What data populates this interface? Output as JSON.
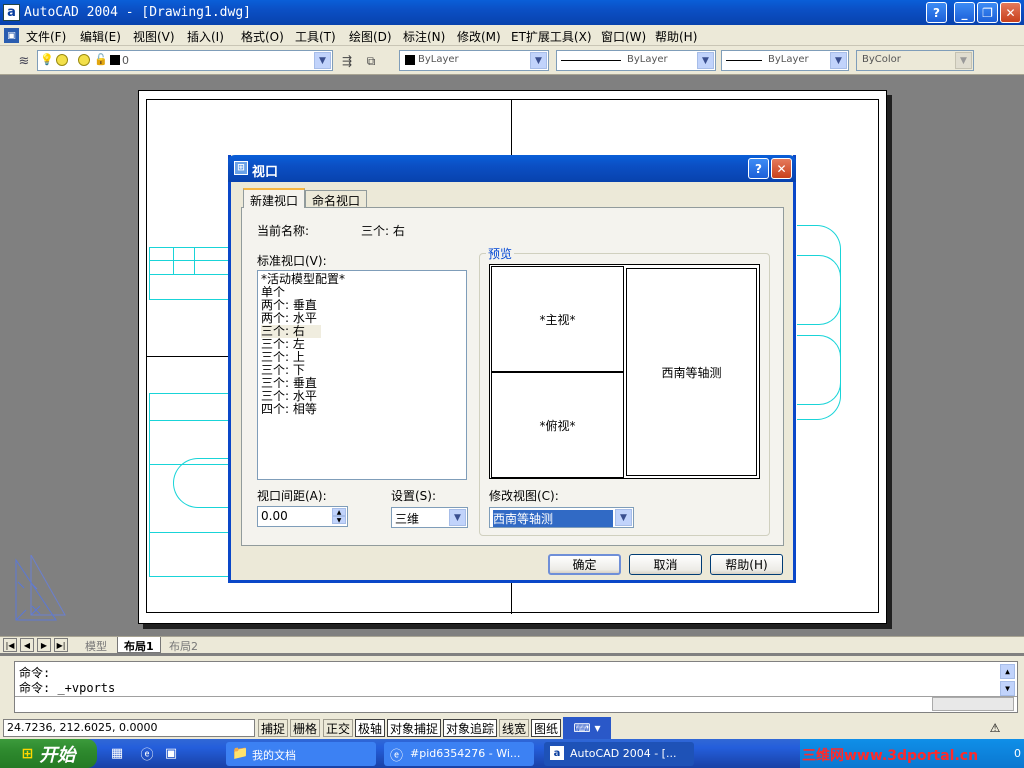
{
  "window": {
    "title": "AutoCAD 2004 - [Drawing1.dwg]",
    "controls": {
      "help": "?",
      "minimize": "_",
      "restore": "❐",
      "close": "✕"
    }
  },
  "menu": [
    "文件(F)",
    "编辑(E)",
    "视图(V)",
    "插入(I)",
    "格式(O)",
    "工具(T)",
    "绘图(D)",
    "标注(N)",
    "修改(M)",
    "ET扩展工具(X)",
    "窗口(W)",
    "帮助(H)"
  ],
  "toolbar": {
    "layer_value": "0",
    "color_value": "ByLayer",
    "linetype_value": "ByLayer",
    "lineweight_value": "ByLayer",
    "plotstyle_value": "ByColor"
  },
  "layout_tabs": [
    "模型",
    "布局1",
    "布局2"
  ],
  "command_lines": [
    "命令:",
    "命令: _+vports"
  ],
  "status": {
    "coords": "24.7236,  212.6025, 0.0000",
    "buttons": [
      "捕捉",
      "栅格",
      "正交",
      "极轴",
      "对象捕捉",
      "对象追踪",
      "线宽",
      "图纸"
    ]
  },
  "taskbar": {
    "start": "开始",
    "tasks": [
      "我的文档",
      "#pid6354276 - Wi...",
      "AutoCAD 2004 - [..."
    ],
    "watermark": "三维网www.3dportal.cn",
    "clock": "0"
  },
  "dialog": {
    "title": "视口",
    "tabs": [
      "新建视口",
      "命名视口"
    ],
    "current_name_label": "当前名称:",
    "current_name_value": "三个: 右",
    "standard_label": "标准视口(V):",
    "list": [
      "*活动模型配置*",
      "单个",
      "两个: 垂直",
      "两个: 水平",
      "三个: 右",
      "三个: 左",
      "三个: 上",
      "三个: 下",
      "三个: 垂直",
      "三个: 水平",
      "四个: 相等"
    ],
    "selected_index": 4,
    "preview_label": "预览",
    "preview_cells": [
      "*主视*",
      "*俯视*",
      "西南等轴测"
    ],
    "spacing_label": "视口间距(A):",
    "spacing_value": "0.00",
    "setup_label": "设置(S):",
    "setup_value": "三维",
    "change_view_label": "修改视图(C):",
    "change_view_value": "西南等轴测",
    "ok": "确定",
    "cancel": "取消",
    "help": "帮助(H)"
  }
}
